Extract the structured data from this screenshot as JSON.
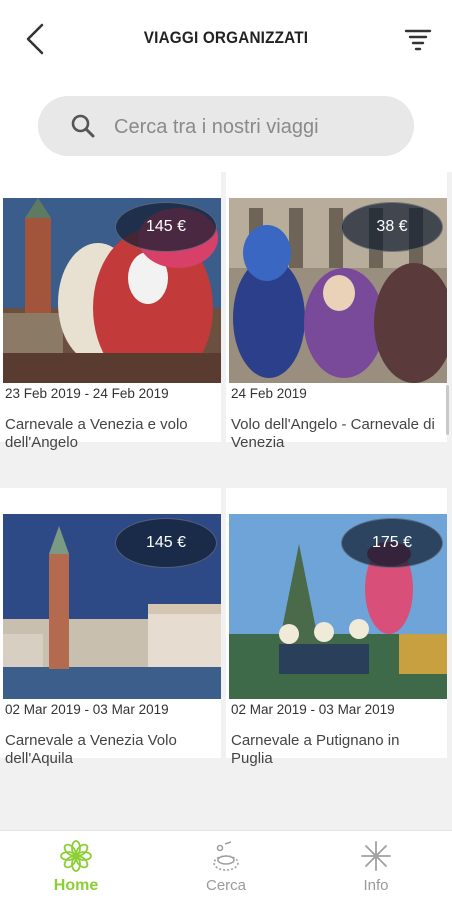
{
  "header": {
    "title": "VIAGGI ORGANIZZATI",
    "back_icon": "chevron-left-icon",
    "filter_icon": "filter-icon"
  },
  "search": {
    "placeholder": "Cerca tra i nostri viaggi",
    "icon": "search-icon"
  },
  "trips": [
    {
      "price": "145 €",
      "dates": "23 Feb 2019 - 24 Feb 2019",
      "name": "Carnevale a Venezia e volo dell'Angelo"
    },
    {
      "price": "38 €",
      "dates": "24 Feb 2019",
      "name": "Volo dell'Angelo - Carnevale di Venezia"
    },
    {
      "price": "145 €",
      "dates": "02 Mar 2019 - 03 Mar 2019",
      "name": "Carnevale a Venezia Volo dell'Aquila"
    },
    {
      "price": "175 €",
      "dates": "02 Mar 2019 - 03 Mar 2019",
      "name": "Carnevale a Putignano in Puglia"
    }
  ],
  "bottom_nav": {
    "items": [
      {
        "label": "Home",
        "icon": "home-flower-icon",
        "active": true
      },
      {
        "label": "Cerca",
        "icon": "search-shape-icon",
        "active": false
      },
      {
        "label": "Info",
        "icon": "info-star-icon",
        "active": false
      }
    ]
  },
  "colors": {
    "accent": "#8ccf35",
    "inactive": "#9a9a9a",
    "search_bg": "#e8e8e8"
  }
}
